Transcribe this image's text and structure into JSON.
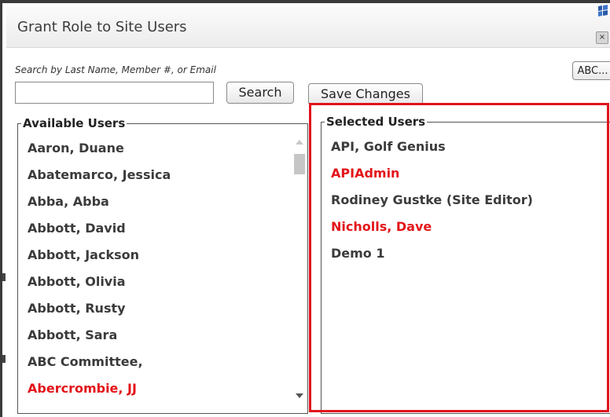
{
  "dialog": {
    "title": "Grant Role to Site Users",
    "search_hint": "Search by Last Name, Member #, or Email",
    "abc_label": "ABC...",
    "search_input": {
      "value": "",
      "placeholder": ""
    },
    "search_label": "Search",
    "save_label": "Save Changes"
  },
  "available": {
    "legend": "Available Users",
    "items": [
      {
        "label": "Aaron, Duane",
        "highlight": false
      },
      {
        "label": "Abatemarco, Jessica",
        "highlight": false
      },
      {
        "label": "Abba, Abba",
        "highlight": false
      },
      {
        "label": "Abbott, David",
        "highlight": false
      },
      {
        "label": "Abbott, Jackson",
        "highlight": false
      },
      {
        "label": "Abbott, Olivia",
        "highlight": false
      },
      {
        "label": "Abbott, Rusty",
        "highlight": false
      },
      {
        "label": "Abbott, Sara",
        "highlight": false
      },
      {
        "label": "ABC Committee,",
        "highlight": false
      },
      {
        "label": "Abercrombie, JJ",
        "highlight": true
      }
    ]
  },
  "selected": {
    "legend": "Selected Users",
    "items": [
      {
        "label": "API, Golf Genius",
        "highlight": false
      },
      {
        "label": "APIAdmin",
        "highlight": true
      },
      {
        "label": "Rodiney Gustke (Site Editor)",
        "highlight": false
      },
      {
        "label": "Nicholls, Dave",
        "highlight": true
      },
      {
        "label": "Demo 1",
        "highlight": false
      }
    ]
  },
  "colors": {
    "highlight_text": "#e3151a",
    "selection_outline": "#e0141e"
  },
  "icons": {
    "title_logo": "logo-icon",
    "close": "close-icon",
    "scroll_up": "scroll-up-arrow-icon",
    "scroll_down": "scroll-down-arrow-icon"
  }
}
